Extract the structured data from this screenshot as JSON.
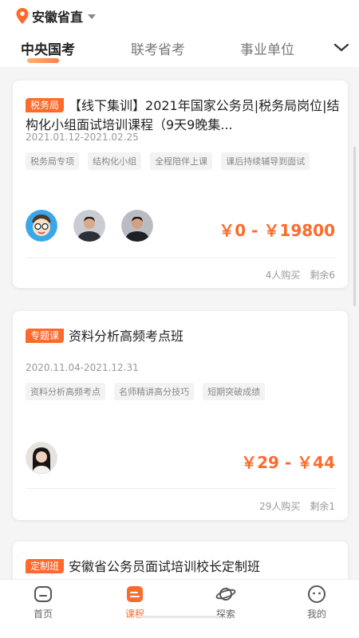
{
  "header": {
    "location": "安徽省直"
  },
  "tabs": [
    {
      "label": "中央国考",
      "active": true
    },
    {
      "label": "联考省考",
      "active": false
    },
    {
      "label": "事业单位",
      "active": false
    }
  ],
  "courses": [
    {
      "badge": "税务局",
      "title": "【线下集训】2021年国家公务员|税务局岗位|结构化小组面试培训课程（9天9晚集...",
      "date": "2021.01.12-2021.02.25",
      "tags": [
        "税务局专项",
        "结构化小组",
        "全程陪伴上课",
        "课后持续辅导到面试"
      ],
      "price": "￥0 - ￥19800",
      "buyers": "4人购买",
      "remaining": "剩余6"
    },
    {
      "badge": "专题课",
      "title": "资料分析高频考点班",
      "date": "2020.11.04-2021.12.31",
      "tags": [
        "资料分析高频考点",
        "名师精讲高分技巧",
        "短期突破成绩"
      ],
      "price": "￥29 - ￥44",
      "buyers": "29人购买",
      "remaining": "剩余1"
    },
    {
      "badge": "定制班",
      "title": "安徽省公务员面试培训校长定制班"
    }
  ],
  "bottom_nav": [
    {
      "label": "首页",
      "icon": "home-icon",
      "active": false
    },
    {
      "label": "课程",
      "icon": "course-icon",
      "active": true
    },
    {
      "label": "探索",
      "icon": "planet-icon",
      "active": false
    },
    {
      "label": "我的",
      "icon": "profile-icon",
      "active": false
    }
  ],
  "colors": {
    "accent": "#ff6a2c",
    "text": "#222222",
    "muted": "#999999"
  }
}
